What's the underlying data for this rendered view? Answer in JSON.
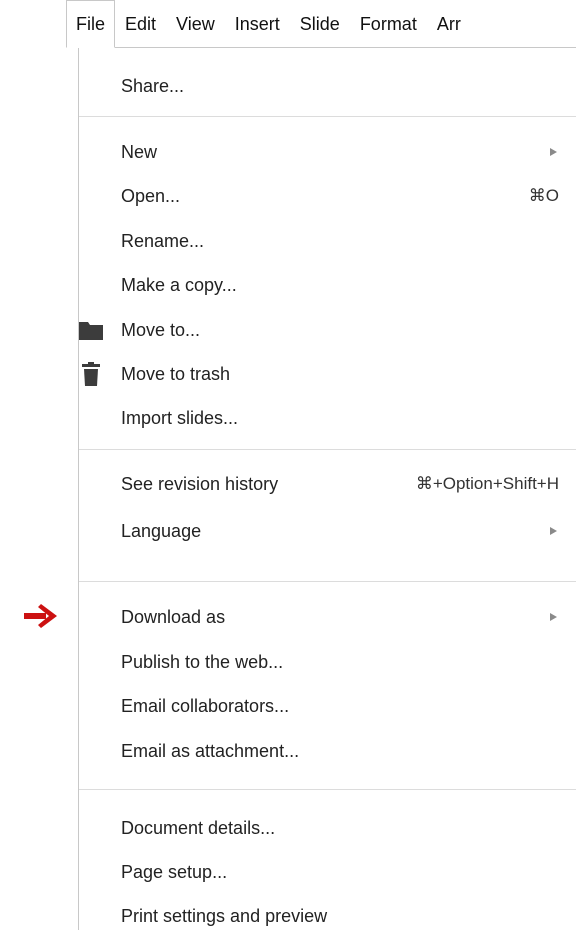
{
  "menubar": {
    "tabs": [
      {
        "label": "File",
        "active": true
      },
      {
        "label": "Edit"
      },
      {
        "label": "View"
      },
      {
        "label": "Insert"
      },
      {
        "label": "Slide"
      },
      {
        "label": "Format"
      },
      {
        "label": "Arr"
      }
    ]
  },
  "menu": {
    "items": [
      {
        "label": "Share..."
      },
      {
        "label": "New",
        "submenu": true
      },
      {
        "label": "Open...",
        "shortcut": "⌘O"
      },
      {
        "label": "Rename..."
      },
      {
        "label": "Make a copy..."
      },
      {
        "label": "Move to...",
        "icon": "folder-icon"
      },
      {
        "label": "Move to trash",
        "icon": "trash-icon"
      },
      {
        "label": "Import slides..."
      },
      {
        "label": "See revision history",
        "shortcut": "⌘+Option+Shift+H"
      },
      {
        "label": "Language",
        "submenu": true
      },
      {
        "label": "Download as",
        "submenu": true
      },
      {
        "label": "Publish to the web..."
      },
      {
        "label": "Email collaborators..."
      },
      {
        "label": "Email as attachment..."
      },
      {
        "label": "Document details..."
      },
      {
        "label": "Page setup..."
      },
      {
        "label": "Print settings and preview"
      }
    ]
  },
  "annotation": {
    "icon": "red-arrow-icon",
    "color": "#cc1111",
    "points_to": "Download as"
  },
  "colors": {
    "menu_border": "#c8c8c8",
    "separator": "#dcdcdc",
    "submenu_arrow": "#8a8a8a",
    "icon": "#3c3c3c"
  }
}
